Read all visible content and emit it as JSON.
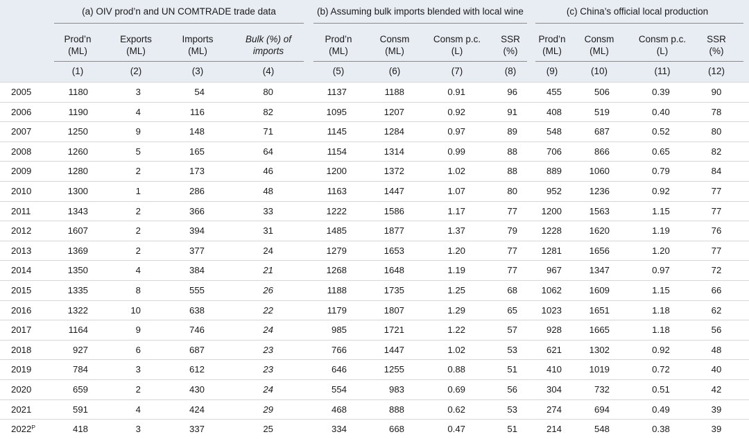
{
  "groups": [
    "(a) OIV prod’n and UN COMTRADE trade data",
    "(b) Assuming bulk imports blended with local wine",
    "(c) China’s official local production"
  ],
  "columns": [
    {
      "l1": "Prod’n",
      "l2": "(ML)",
      "num": "(1)"
    },
    {
      "l1": "Exports",
      "l2": "(ML)",
      "num": "(2)"
    },
    {
      "l1": "Imports",
      "l2": "(ML)",
      "num": "(3)"
    },
    {
      "l1": "Bulk (%) of",
      "l2": "imports",
      "num": "(4)"
    },
    {
      "l1": "Prod’n",
      "l2": "(ML)",
      "num": "(5)"
    },
    {
      "l1": "Consm",
      "l2": "(ML)",
      "num": "(6)"
    },
    {
      "l1": "Consm p.c.",
      "l2": "(L)",
      "num": "(7)"
    },
    {
      "l1": "SSR",
      "l2": "(%)",
      "num": "(8)"
    },
    {
      "l1": "Prod’n",
      "l2": "(ML)",
      "num": "(9)"
    },
    {
      "l1": "Consm",
      "l2": "(ML)",
      "num": "(10)"
    },
    {
      "l1": "Consm p.c.",
      "l2": "(L)",
      "num": "(11)"
    },
    {
      "l1": "SSR",
      "l2": "(%)",
      "num": "(12)"
    }
  ],
  "rows": [
    {
      "year": "2005",
      "cells": [
        "1180",
        "3",
        "54",
        "80",
        "1137",
        "1188",
        "0.91",
        "96",
        "455",
        "506",
        "0.39",
        "90"
      ]
    },
    {
      "year": "2006",
      "cells": [
        "1190",
        "4",
        "116",
        "82",
        "1095",
        "1207",
        "0.92",
        "91",
        "408",
        "519",
        "0.40",
        "78"
      ]
    },
    {
      "year": "2007",
      "cells": [
        "1250",
        "9",
        "148",
        "71",
        "1145",
        "1284",
        "0.97",
        "89",
        "548",
        "687",
        "0.52",
        "80"
      ]
    },
    {
      "year": "2008",
      "cells": [
        "1260",
        "5",
        "165",
        "64",
        "1154",
        "1314",
        "0.99",
        "88",
        "706",
        "866",
        "0.65",
        "82"
      ]
    },
    {
      "year": "2009",
      "cells": [
        "1280",
        "2",
        "173",
        "46",
        "1200",
        "1372",
        "1.02",
        "88",
        "889",
        "1060",
        "0.79",
        "84"
      ]
    },
    {
      "year": "2010",
      "cells": [
        "1300",
        "1",
        "286",
        "48",
        "1163",
        "1447",
        "1.07",
        "80",
        "952",
        "1236",
        "0.92",
        "77"
      ]
    },
    {
      "year": "2011",
      "cells": [
        "1343",
        "2",
        "366",
        "33",
        "1222",
        "1586",
        "1.17",
        "77",
        "1200",
        "1563",
        "1.15",
        "77"
      ]
    },
    {
      "year": "2012",
      "cells": [
        "1607",
        "2",
        "394",
        "31",
        "1485",
        "1877",
        "1.37",
        "79",
        "1228",
        "1620",
        "1.19",
        "76"
      ]
    },
    {
      "year": "2013",
      "cells": [
        "1369",
        "2",
        "377",
        "24",
        "1279",
        "1653",
        "1.20",
        "77",
        "1281",
        "1656",
        "1.20",
        "77"
      ]
    },
    {
      "year": "2014",
      "cells": [
        "1350",
        "4",
        "384",
        "21",
        "1268",
        "1648",
        "1.19",
        "77",
        "967",
        "1347",
        "0.97",
        "72"
      ]
    },
    {
      "year": "2015",
      "cells": [
        "1335",
        "8",
        "555",
        "26",
        "1188",
        "1735",
        "1.25",
        "68",
        "1062",
        "1609",
        "1.15",
        "66"
      ]
    },
    {
      "year": "2016",
      "cells": [
        "1322",
        "10",
        "638",
        "22",
        "1179",
        "1807",
        "1.29",
        "65",
        "1023",
        "1651",
        "1.18",
        "62"
      ]
    },
    {
      "year": "2017",
      "cells": [
        "1164",
        "9",
        "746",
        "24",
        "985",
        "1721",
        "1.22",
        "57",
        "928",
        "1665",
        "1.18",
        "56"
      ]
    },
    {
      "year": "2018",
      "cells": [
        "927",
        "6",
        "687",
        "23",
        "766",
        "1447",
        "1.02",
        "53",
        "621",
        "1302",
        "0.92",
        "48"
      ]
    },
    {
      "year": "2019",
      "cells": [
        "784",
        "3",
        "612",
        "23",
        "646",
        "1255",
        "0.88",
        "51",
        "410",
        "1019",
        "0.72",
        "40"
      ]
    },
    {
      "year": "2020",
      "cells": [
        "659",
        "2",
        "430",
        "24",
        "554",
        "983",
        "0.69",
        "56",
        "304",
        "732",
        "0.51",
        "42"
      ]
    },
    {
      "year": "2021",
      "cells": [
        "591",
        "4",
        "424",
        "29",
        "468",
        "888",
        "0.62",
        "53",
        "274",
        "694",
        "0.49",
        "39"
      ]
    },
    {
      "year": "2022",
      "year_sup": "P",
      "cells": [
        "418",
        "3",
        "337",
        "25",
        "334",
        "668",
        "0.47",
        "51",
        "214",
        "548",
        "0.38",
        "39"
      ]
    }
  ],
  "italic_bulk_years": [
    "2014",
    "2015",
    "2016",
    "2017",
    "2018",
    "2019",
    "2020",
    "2021"
  ]
}
